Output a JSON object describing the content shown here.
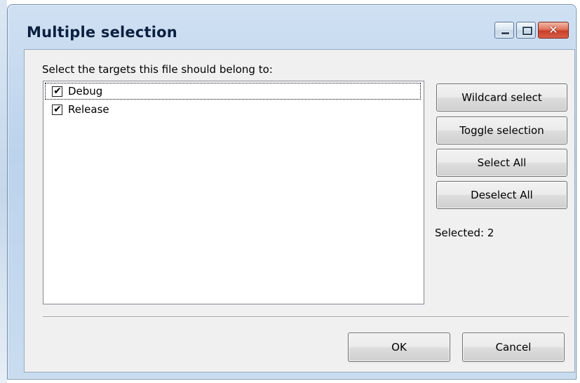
{
  "window": {
    "title": "Multiple selection",
    "caption_buttons": {
      "minimize_icon": "minimize-icon",
      "maximize_icon": "maximize-icon",
      "close_icon": "close-icon",
      "close_glyph": "✕"
    }
  },
  "dialog": {
    "prompt": "Select the targets this file should belong to:",
    "targets": [
      {
        "label": "Debug",
        "checked": true,
        "check_glyph": "✔"
      },
      {
        "label": "Release",
        "checked": true,
        "check_glyph": "✔"
      }
    ],
    "side_buttons": {
      "wildcard_select": "Wildcard select",
      "toggle_selection": "Toggle selection",
      "select_all": "Select All",
      "deselect_all": "Deselect All"
    },
    "selected_count": "Selected: 2",
    "ok_label": "OK",
    "cancel_label": "Cancel"
  },
  "colors": {
    "frame": "#bcd3ec",
    "client": "#f0f0f0",
    "close_button": "#c8402a"
  }
}
